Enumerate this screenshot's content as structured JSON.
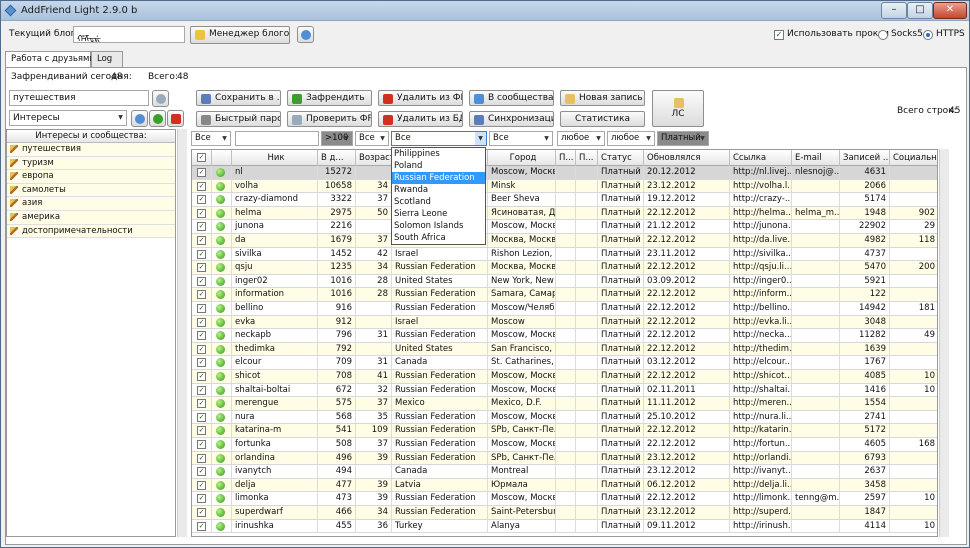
{
  "window": {
    "title": "AddFriend Light 2.9.0 b",
    "btn_min": "–",
    "btn_max": "□",
    "btn_close": "✕"
  },
  "toolbar": {
    "blog_label": "Текущий блог :",
    "blog_value": "ᡥᡯᢑᡩ",
    "blog_manager": "Менеджер блогов...",
    "use_proxy": "Использовать прокси",
    "socks": "Socks5",
    "https": "HTTPS"
  },
  "tabs": [
    "Работа с друзьями",
    "Log"
  ],
  "stats": {
    "today_label": "Зафрендиваний сегодня:",
    "today_value": "48",
    "total_label": "Всего:",
    "total_value": "48",
    "rows_label": "Всего строк:",
    "rows_value": "45"
  },
  "search": {
    "value": "путешествия",
    "category": "Интересы"
  },
  "buttons": {
    "save": "Сохранить в ...",
    "friend": "Зафрендить",
    "remove_fr": "Удалить из ФР",
    "to_comm": "В сообщества",
    "new_rec": "Новая запись",
    "parse": "Быстрый парсинг",
    "check_fr": "Проверить ФР",
    "remove_db": "Удалить из БД",
    "sync": "Синхронизация",
    "stats": "Статистика",
    "ls": "ЛС"
  },
  "interests": {
    "header": "Интересы и сообщества:",
    "items": [
      "путешествия",
      "туризм",
      "европа",
      "самолеты",
      "азия",
      "америка",
      "достопримечательности"
    ]
  },
  "filters": {
    "f1": "Все",
    "f3": ">100",
    "f4": "Все",
    "f5": "Все",
    "f6": "Все",
    "f7": "любое",
    "f8": "любое",
    "f9": "Платный"
  },
  "dropdown": [
    "Philippines",
    "Poland",
    "Russian Federation",
    "Rwanda",
    "Scotland",
    "Sierra Leone",
    "Solomon Islands",
    "South Africa"
  ],
  "columns": [
    "Ник",
    "В д...",
    "Возраст",
    "",
    "Город",
    "П...",
    "П...",
    "Статус",
    "Обновлялся",
    "Ссылка",
    "E-mail",
    "Записей ...",
    "Социальн..."
  ],
  "rows": [
    [
      "nl",
      "15272",
      "",
      "",
      "Moscow, Москва",
      "Платный",
      "20.12.2012",
      "http://nl.livej...",
      "nlesnoj@...",
      "4631",
      ""
    ],
    [
      "volha",
      "10658",
      "34",
      "",
      "Minsk",
      "Платный",
      "23.12.2012",
      "http://volha.l...",
      "",
      "2066",
      ""
    ],
    [
      "crazy-diamond",
      "3322",
      "37",
      "",
      "Beer Sheva",
      "Платный",
      "19.12.2012",
      "http://crazy-...",
      "",
      "5174",
      ""
    ],
    [
      "helma",
      "2975",
      "50",
      "",
      "Ясиноватая, Д...",
      "Платный",
      "22.12.2012",
      "http://helma....",
      "helma_m...",
      "1948",
      "902"
    ],
    [
      "junona",
      "2216",
      "",
      "",
      "Moscow, Москва",
      "Платный",
      "21.12.2012",
      "http://junona...",
      "",
      "22902",
      "29"
    ],
    [
      "da",
      "1679",
      "37",
      "",
      "Москва, Москва",
      "Платный",
      "22.12.2012",
      "http://da.live...",
      "",
      "4982",
      "118"
    ],
    [
      "sivilka",
      "1452",
      "42",
      "Israel",
      "Rishon Lezion, ...",
      "Платный",
      "23.11.2012",
      "http://sivilka....",
      "",
      "4737",
      ""
    ],
    [
      "qsju",
      "1235",
      "34",
      "Russian Federation",
      "Москва, Москва",
      "Платный",
      "22.12.2012",
      "http://qsju.li...",
      "",
      "5470",
      "200"
    ],
    [
      "inger02",
      "1016",
      "28",
      "United States",
      "New York, New ...",
      "Платный",
      "03.09.2012",
      "http://inger0...",
      "",
      "5921",
      ""
    ],
    [
      "information",
      "1016",
      "28",
      "Russian Federation",
      "Samara, Самар...",
      "Платный",
      "22.12.2012",
      "http://inform...",
      "",
      "122",
      ""
    ],
    [
      "bellino",
      "916",
      "",
      "Russian Federation",
      "Moscow/Челяб...",
      "Платный",
      "22.12.2012",
      "http://bellino...",
      "",
      "14942",
      "181"
    ],
    [
      "evka",
      "912",
      "",
      "Israel",
      "Moscow",
      "Платный",
      "22.12.2012",
      "http://evka.li...",
      "",
      "3048",
      ""
    ],
    [
      "neckapb",
      "796",
      "31",
      "Russian Federation",
      "Moscow, Москва",
      "Платный",
      "22.12.2012",
      "http://necka...",
      "",
      "11282",
      "49"
    ],
    [
      "thedimka",
      "792",
      "",
      "United States",
      "San Francisco, ...",
      "Платный",
      "22.12.2012",
      "http://thedim...",
      "",
      "1639",
      ""
    ],
    [
      "elcour",
      "709",
      "31",
      "Canada",
      "St. Catharines, ...",
      "Платный",
      "03.12.2012",
      "http://elcour...",
      "",
      "1767",
      ""
    ],
    [
      "shicot",
      "708",
      "41",
      "Russian Federation",
      "Moscow, Москва",
      "Платный",
      "22.12.2012",
      "http://shicot...",
      "",
      "4085",
      "10"
    ],
    [
      "shaltai-boltai",
      "672",
      "32",
      "Russian Federation",
      "Moscow, Москва",
      "Платный",
      "02.11.2011",
      "http://shaltai...",
      "",
      "1416",
      "10"
    ],
    [
      "merengue",
      "575",
      "37",
      "Mexico",
      "Mexico, D.F.",
      "Платный",
      "11.11.2012",
      "http://meren...",
      "",
      "1554",
      ""
    ],
    [
      "nura",
      "568",
      "35",
      "Russian Federation",
      "Moscow, Москва",
      "Платный",
      "25.10.2012",
      "http://nura.li...",
      "",
      "2741",
      ""
    ],
    [
      "katarina-m",
      "541",
      "109",
      "Russian Federation",
      "SPb, Санкт-Пе...",
      "Платный",
      "22.12.2012",
      "http://katarin...",
      "",
      "5172",
      ""
    ],
    [
      "fortunka",
      "508",
      "37",
      "Russian Federation",
      "Moscow, Москва",
      "Платный",
      "22.12.2012",
      "http://fortun...",
      "",
      "4605",
      "168"
    ],
    [
      "orlandina",
      "496",
      "39",
      "Russian Federation",
      "SPb, Санкт-Пе...",
      "Платный",
      "23.12.2012",
      "http://orlandi...",
      "",
      "6793",
      ""
    ],
    [
      "ivanytch",
      "494",
      "",
      "Canada",
      "Montreal",
      "Платный",
      "23.12.2012",
      "http://ivanyt...",
      "",
      "2637",
      ""
    ],
    [
      "delja",
      "477",
      "39",
      "Latvia",
      "Юрмала",
      "Платный",
      "06.12.2012",
      "http://delja.li...",
      "",
      "3458",
      ""
    ],
    [
      "limonka",
      "473",
      "39",
      "Russian Federation",
      "Moscow, Москва",
      "Платный",
      "22.12.2012",
      "http://limonk...",
      "tenng@m...",
      "2597",
      "10"
    ],
    [
      "superdwarf",
      "466",
      "34",
      "Russian Federation",
      "Saint-Petersburg",
      "Платный",
      "23.12.2012",
      "http://superd...",
      "",
      "1847",
      ""
    ],
    [
      "irinushka",
      "455",
      "36",
      "Turkey",
      "Alanya",
      "Платный",
      "09.11.2012",
      "http://irinush...",
      "",
      "4114",
      "10"
    ]
  ]
}
